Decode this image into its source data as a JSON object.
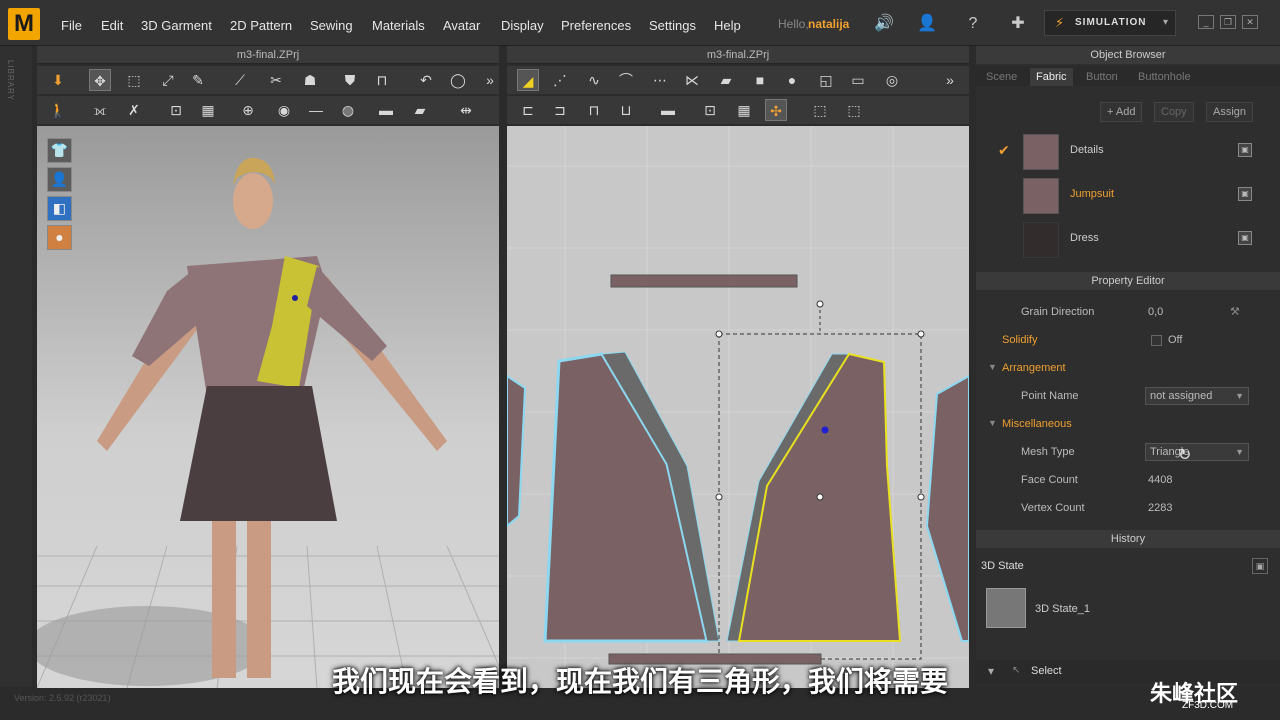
{
  "app": {
    "logo": "M"
  },
  "menu": [
    "File",
    "Edit",
    "3D Garment",
    "2D Pattern",
    "Sewing",
    "Materials",
    "Avatar",
    "Display",
    "Preferences",
    "Settings",
    "Help"
  ],
  "user": {
    "hello": "Hello,",
    "name": "natalija"
  },
  "simulation": {
    "label": "SIMULATION"
  },
  "panels": {
    "left_title": "m3-final.ZPrj",
    "center_title": "m3-final.ZPrj"
  },
  "object_browser": {
    "title": "Object Browser",
    "tabs": [
      "Scene",
      "Fabric",
      "Button",
      "Buttonhole"
    ],
    "active_tab": "Fabric",
    "buttons": {
      "add": "+ Add",
      "copy": "Copy",
      "assign": "Assign"
    },
    "fabrics": [
      {
        "name": "Details",
        "checked": true
      },
      {
        "name": "Jumpsuit",
        "selected": true
      },
      {
        "name": "Dress"
      }
    ]
  },
  "property_editor": {
    "title": "Property Editor",
    "grain_direction": {
      "label": "Grain Direction",
      "value": "0,0"
    },
    "solidify": {
      "label": "Solidify",
      "value": "Off"
    },
    "arrangement": {
      "label": "Arrangement",
      "point_name_label": "Point Name",
      "point_name_value": "not assigned"
    },
    "misc": {
      "label": "Miscellaneous",
      "mesh_type_label": "Mesh Type",
      "mesh_type_value": "Triangle",
      "face_count_label": "Face Count",
      "face_count_value": "4408",
      "vertex_count_label": "Vertex Count",
      "vertex_count_value": "2283"
    }
  },
  "history": {
    "title": "History",
    "state_label": "3D State",
    "item": "3D State_1",
    "select": "Select"
  },
  "library_label": "LIBRARY",
  "version": "Version: 2.5.92    (r23021)",
  "subtitle": "我们现在会看到，现在我们有三角形，我们将需要",
  "watermark": {
    "main": "朱峰社区",
    "sub": "ZF3D.COM"
  },
  "colors": {
    "accent": "#f0a030",
    "fabric": "#7a6264",
    "selected_outline": "#e8e020",
    "outline": "#70d0f0"
  }
}
